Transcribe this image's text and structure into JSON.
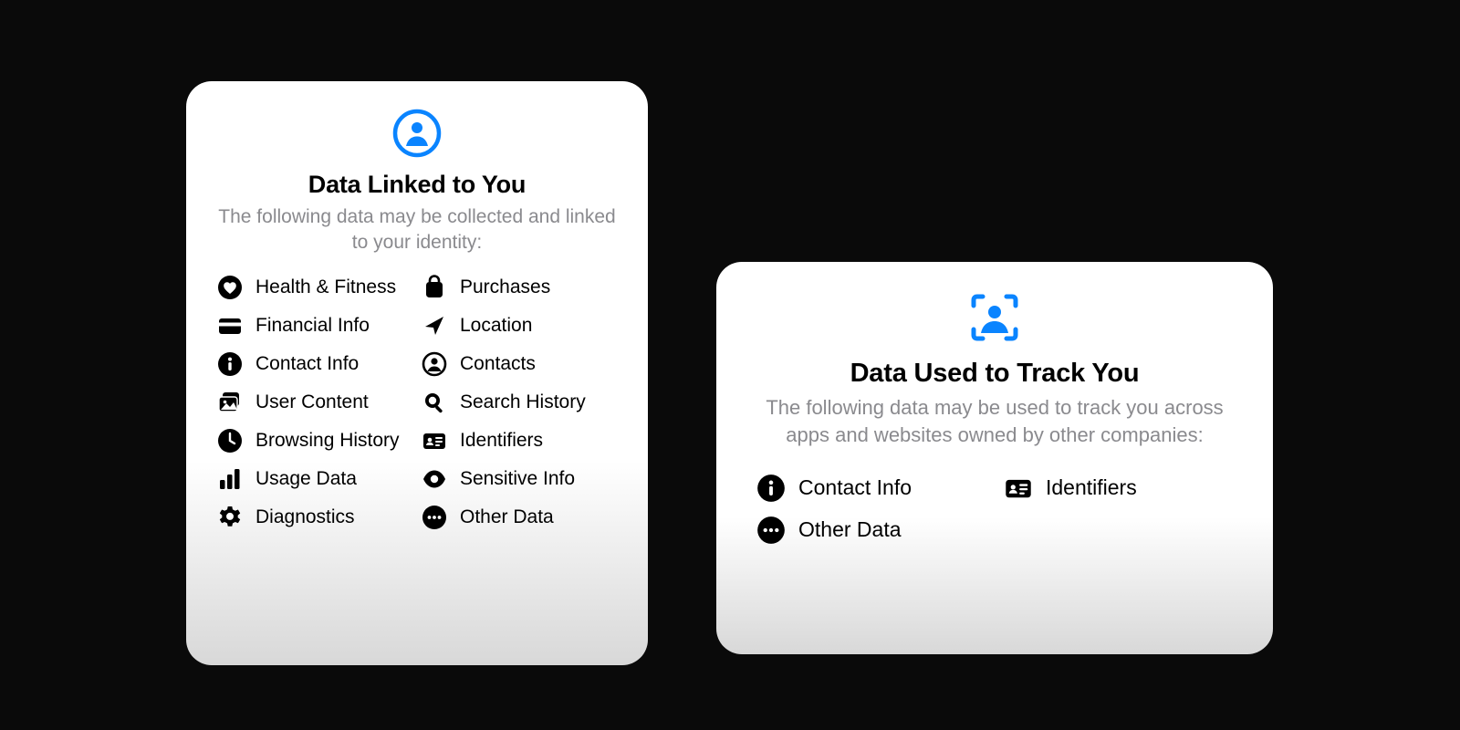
{
  "colors": {
    "accent": "#0a84ff",
    "icon": "#000000",
    "sub": "#8a8a8e"
  },
  "cards": {
    "linked": {
      "title": "Data Linked to You",
      "subtitle": "The following data may be collected and linked to your identity:",
      "left": [
        {
          "icon": "heart-circle-icon",
          "label": "Health & Fitness"
        },
        {
          "icon": "credit-card-icon",
          "label": "Financial Info"
        },
        {
          "icon": "info-circle-icon",
          "label": "Contact Info"
        },
        {
          "icon": "photo-stack-icon",
          "label": "User Content"
        },
        {
          "icon": "clock-icon",
          "label": "Browsing History"
        },
        {
          "icon": "bar-chart-icon",
          "label": "Usage Data"
        },
        {
          "icon": "gear-icon",
          "label": "Diagnostics"
        }
      ],
      "right": [
        {
          "icon": "bag-icon",
          "label": "Purchases"
        },
        {
          "icon": "location-arrow-icon",
          "label": "Location"
        },
        {
          "icon": "person-circle-icon",
          "label": "Contacts"
        },
        {
          "icon": "magnifier-icon",
          "label": "Search History"
        },
        {
          "icon": "id-card-icon",
          "label": "Identifiers"
        },
        {
          "icon": "eye-icon",
          "label": "Sensitive Info"
        },
        {
          "icon": "ellipsis-circle-icon",
          "label": "Other Data"
        }
      ]
    },
    "track": {
      "title": "Data Used to Track You",
      "subtitle": "The following data may be used to track you across apps and websites owned by other companies:",
      "left": [
        {
          "icon": "info-circle-icon",
          "label": "Contact Info"
        },
        {
          "icon": "ellipsis-circle-icon",
          "label": "Other Data"
        }
      ],
      "right": [
        {
          "icon": "id-card-icon",
          "label": "Identifiers"
        }
      ]
    }
  }
}
